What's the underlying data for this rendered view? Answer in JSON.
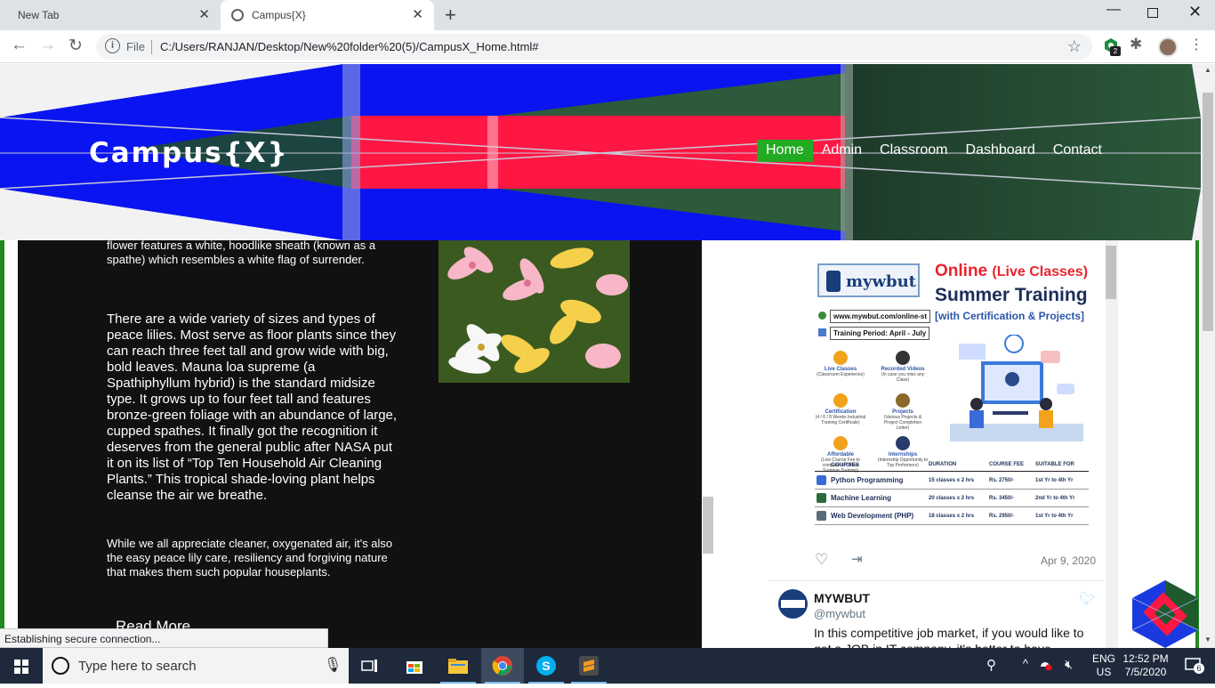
{
  "browser": {
    "tabs": [
      {
        "title": "New Tab",
        "active": false
      },
      {
        "title": "Campus{X}",
        "active": true
      }
    ],
    "new_tab_symbol": "+",
    "window_controls": [
      "minimize",
      "restore",
      "close"
    ],
    "address": {
      "scheme_label": "File",
      "url": "C:/Users/RANJAN/Desktop/New%20folder%20(5)/CampusX_Home.html#"
    },
    "extension_badge": "2",
    "status_text": "Establishing secure connection..."
  },
  "site": {
    "logo": "Campus{X}",
    "nav": [
      {
        "label": "Home",
        "active": true
      },
      {
        "label": "Admin",
        "active": false
      },
      {
        "label": "Classroom",
        "active": false
      },
      {
        "label": "Dashboard",
        "active": false
      },
      {
        "label": "Contact",
        "active": false
      }
    ],
    "article": {
      "p1": "flower features a white, hoodlike sheath (known as a spathe) which resembles a white flag of surrender.",
      "p2": "There are a wide variety of sizes and types of peace lilies. Most serve as floor plants since they can reach three feet tall and grow wide with big, bold leaves. Mauna loa supreme (a Spathiphyllum hybrid) is the standard midsize type. It grows up to four feet tall and features bronze-green foliage with an abundance of large, cupped spathes. It finally got the recognition it deserves from the general public after NASA put it on its list of “Top Ten Household Air Cleaning Plants.” This tropical shade-loving plant helps cleanse the air we breathe.",
      "p3": "While we all appreciate cleaner, oxygenated air, it's also the easy peace lily care, resiliency and forgiving nature that makes them such popular houseplants.",
      "read_more": "Read More"
    }
  },
  "twitter": {
    "ad": {
      "logo": "mywbut",
      "title_a": "Online",
      "title_b": "(Live Classes)",
      "title2": "Summer Training",
      "title3": "[with Certification & Projects]",
      "url": "www.mywbut.com/online-st",
      "period": "Training Period: April - July",
      "features": [
        {
          "title": "Live Classes",
          "sub": "(Classroom Experience)"
        },
        {
          "title": "Recorded Videos",
          "sub": "(In case you miss any Class)"
        },
        {
          "title": "Certification",
          "sub": "(4 / 6 / 8 Weeks Industrial Training Certificate)"
        },
        {
          "title": "Projects",
          "sub": "(Various Projects & Project Completion Letter)"
        },
        {
          "title": "Affordable",
          "sub": "(Low Course Fee to compare to Offline Summer Training)"
        },
        {
          "title": "Internships",
          "sub": "(Internship Opportunity to Top Performers)"
        }
      ],
      "table_headers": [
        "COURSES",
        "DURATION",
        "COURSE FEE",
        "SUITABLE FOR"
      ],
      "rows": [
        {
          "course": "Python Programming",
          "duration": "15 classes x 2 hrs",
          "fee": "Rs. 2750/-",
          "suitable": "1st Yr to 4th Yr"
        },
        {
          "course": "Machine Learning",
          "duration": "20 classes x 2 hrs",
          "fee": "Rs. 3450/-",
          "suitable": "2nd Yr to 4th Yr"
        },
        {
          "course": "Web Development (PHP)",
          "duration": "18 classes x 2 hrs",
          "fee": "Rs. 2950/-",
          "suitable": "1st Yr to 4th Yr"
        }
      ]
    },
    "tweet1_date": "Apr 9, 2020",
    "tweet2": {
      "name": "MYWBUT",
      "handle": "@mywbut",
      "text": "In this competitive job market, if you would like to get a JOB in IT company, it's better to have"
    }
  },
  "taskbar": {
    "search_placeholder": "Type here to search",
    "lang1": "ENG",
    "lang2": "US",
    "time": "12:52 PM",
    "date": "7/5/2020",
    "notifications": "6"
  },
  "colors": {
    "nav_active": "#22aa22",
    "header_blue": "#0a14f0",
    "header_red": "#ff1744",
    "header_green": "#1e4a2e"
  }
}
